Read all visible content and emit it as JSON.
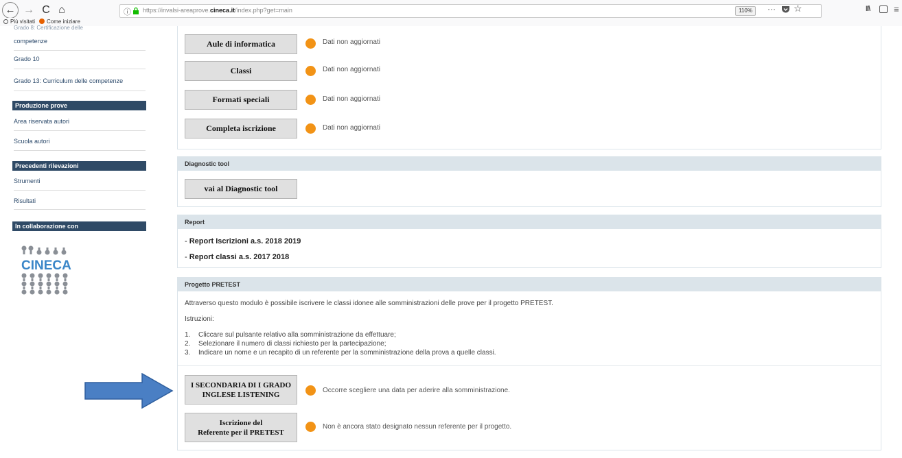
{
  "browser": {
    "url_host_prefix": "https://invalsi-areaprove.",
    "url_host_domain": "cineca.it",
    "url_path": "/index.php?get=main",
    "zoom": "110%",
    "nav": {
      "back": "←",
      "forward": "→",
      "reload": "C",
      "home": "⌂"
    },
    "more": "···",
    "star": "☆",
    "library": "II\\",
    "menu": "≡",
    "bookmarks": [
      {
        "label": "Più visitati"
      },
      {
        "label": "Come iniziare"
      }
    ]
  },
  "sidebar": {
    "cut_item": "Grado 8: Certificazione delle",
    "items_top": [
      "competenze",
      "Grado 10",
      "Grado 13: Curriculum delle competenze"
    ],
    "sections": [
      {
        "title": "Produzione prove",
        "items": [
          "Area riservata autori",
          "Scuola autori"
        ]
      },
      {
        "title": "Precedenti rilevazioni",
        "items": [
          "Strumenti",
          "Risultati"
        ]
      },
      {
        "title": "In collaborazione con",
        "items": []
      }
    ],
    "logo_text": "CINECA"
  },
  "status_color": "#f29316",
  "registration": {
    "buttons": [
      {
        "label": "Aule di informatica",
        "status": "Dati non aggiornati"
      },
      {
        "label": "Classi",
        "status": "Dati non aggiornati"
      },
      {
        "label": "Formati speciali",
        "status": "Dati non aggiornati"
      },
      {
        "label": "Completa iscrizione",
        "status": "Dati non aggiornati"
      }
    ]
  },
  "diagnostic": {
    "title": "Diagnostic tool",
    "button": "vai al Diagnostic tool"
  },
  "report": {
    "title": "Report",
    "links": [
      "Report Iscrizioni a.s. 2018 2019",
      "Report classi a.s. 2017 2018"
    ]
  },
  "pretest": {
    "title": "Progetto PRETEST",
    "intro": "Attraverso questo modulo è possibile iscrivere le classi idonee alle somministrazioni delle prove per il progetto PRETEST.",
    "instructions_label": "Istruzioni:",
    "steps": [
      {
        "num": "1.",
        "text": "Cliccare sul pulsante relativo alla somministrazione da effettuare;"
      },
      {
        "num": "2.",
        "text": "Selezionare il numero di classi richiesto per la partecipazione;"
      },
      {
        "num": "3.",
        "text": "Indicare un nome e un recapito di un referente per la somministrazione della prova a quelle classi."
      }
    ],
    "buttons": [
      {
        "line1": "I SECONDARIA DI I GRADO",
        "line2": "INGLESE LISTENING",
        "status": "Occorre scegliere una data per aderire alla somministrazione."
      },
      {
        "line1": "Iscrizione del",
        "line2": "Referente per il PRETEST",
        "status": "Non è ancora stato designato nessun referente per il progetto."
      }
    ]
  },
  "annotation_arrow_color": "#4a7fc4"
}
